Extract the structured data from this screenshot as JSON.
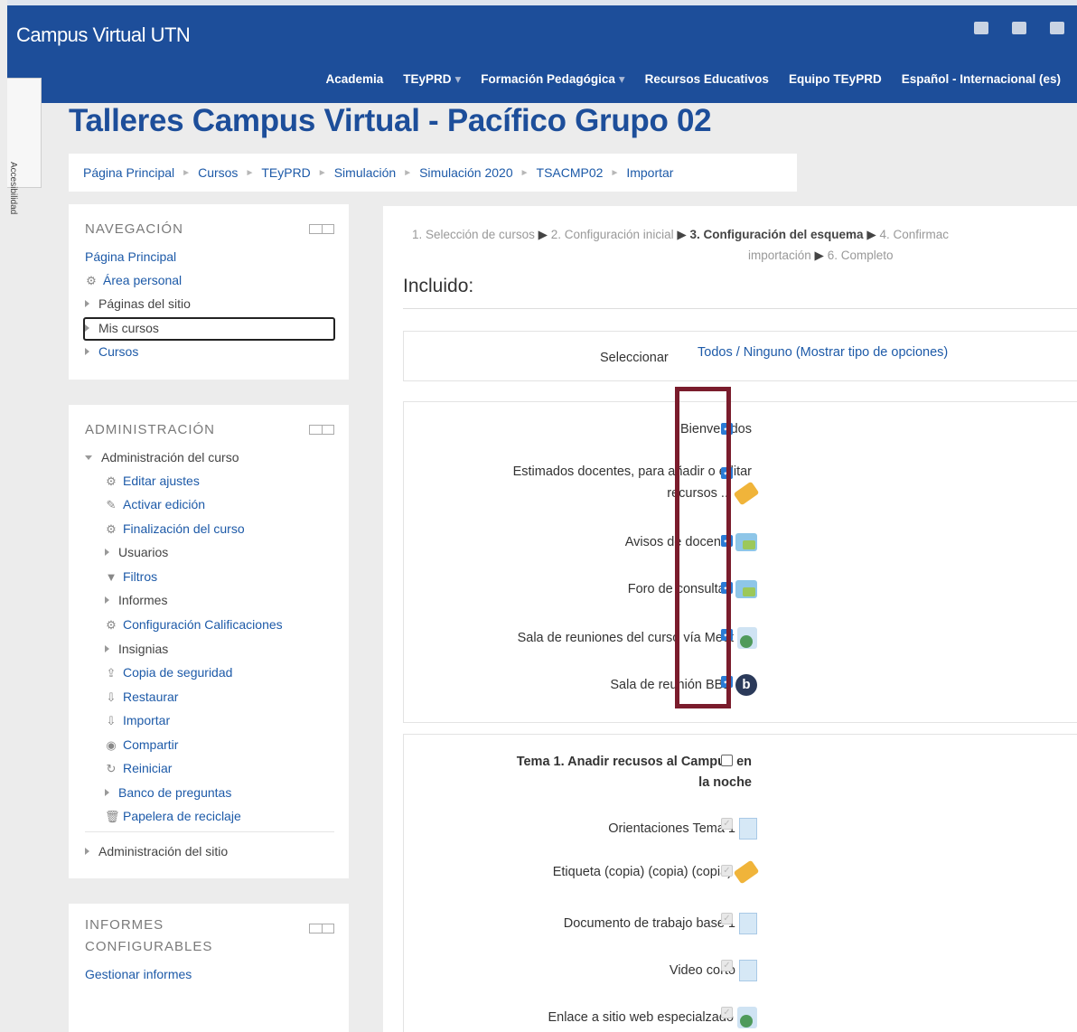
{
  "navbar": {
    "brand": "Campus Virtual UTN",
    "menu": [
      "Academia",
      "TEyPRD",
      "Formación Pedagógica",
      "Recursos Educativos",
      "Equipo TEyPRD",
      "Español - Internacional (es)"
    ],
    "icons": [
      "envelope-icon",
      "bell-icon",
      "chat-icon"
    ]
  },
  "accessibility_tab": "Accesibilidad",
  "course_title": "Talleres Campus Virtual - Pacífico Grupo 02",
  "breadcrumb": [
    "Página Principal",
    "Cursos",
    "TEyPRD",
    "Simulación",
    "Simulación 2020",
    "TSACMP02",
    "Importar"
  ],
  "nav_block": {
    "title": "NAVEGACIÓN",
    "items": [
      "Página Principal",
      "Área personal",
      "Páginas del sitio",
      "Mis cursos",
      "Cursos"
    ]
  },
  "admin_block": {
    "title": "ADMINISTRACIÓN",
    "course_admin": "Administración del curso",
    "items": [
      "Editar ajustes",
      "Activar edición",
      "Finalización del curso",
      "Usuarios",
      "Filtros",
      "Informes",
      "Configuración Calificaciones",
      "Insignias",
      "Copia de seguridad",
      "Restaurar",
      "Importar",
      "Compartir",
      "Reiniciar",
      "Banco de preguntas",
      "Papelera de reciclaje"
    ],
    "site_admin": "Administración del sitio"
  },
  "reports_block": {
    "title_line1": "INFORMES",
    "title_line2": "CONFIGURABLES",
    "link": "Gestionar informes"
  },
  "steps": {
    "s1": "1. Selección de cursos",
    "s2": "2. Configuración inicial",
    "s3": "3. Configuración del esquema",
    "s4": "4. Confirmac",
    "s5": "importación",
    "s6": "6. Completo"
  },
  "included_title": "Incluido:",
  "select": {
    "label": "Seleccionar",
    "link": "Todos / Ninguno (Mostrar tipo de opciones)"
  },
  "section0": {
    "items": [
      {
        "label": "Bienvenidos",
        "icon": "none",
        "checked": true
      },
      {
        "label": "Estimados docentes, para añadir o editar",
        "label2": "recursos ...",
        "icon": "label-tag-icon",
        "checked": true
      },
      {
        "label": "Avisos de docente",
        "icon": "forum-icon",
        "checked": true
      },
      {
        "label": "Foro de consultas",
        "icon": "forum-icon",
        "checked": true
      },
      {
        "label": "Sala de reuniones del curso vía Meet",
        "icon": "url-icon",
        "checked": true
      },
      {
        "label": "Sala de reunión BBB",
        "icon": "bigbluebutton-icon",
        "checked": true
      }
    ]
  },
  "section1": {
    "title_line1": "Tema 1. Anadir recusos al Campus en",
    "title_line2": "la noche",
    "items": [
      {
        "label": "Orientaciones Tema 1",
        "icon": "page-icon"
      },
      {
        "label": "Etiqueta (copia) (copia) (copia)",
        "icon": "label-tag-icon"
      },
      {
        "label": "Documento de trabajo base 1",
        "icon": "page-icon"
      },
      {
        "label": "Video corto",
        "icon": "page-icon"
      },
      {
        "label": "Enlace a sitio web especialzado",
        "icon": "url-icon"
      }
    ]
  },
  "colors": {
    "navbar": "#1d4e9a",
    "link": "#1d5aa8",
    "highlight": "#7a1c2c",
    "checkbox": "#2a7bd5"
  }
}
